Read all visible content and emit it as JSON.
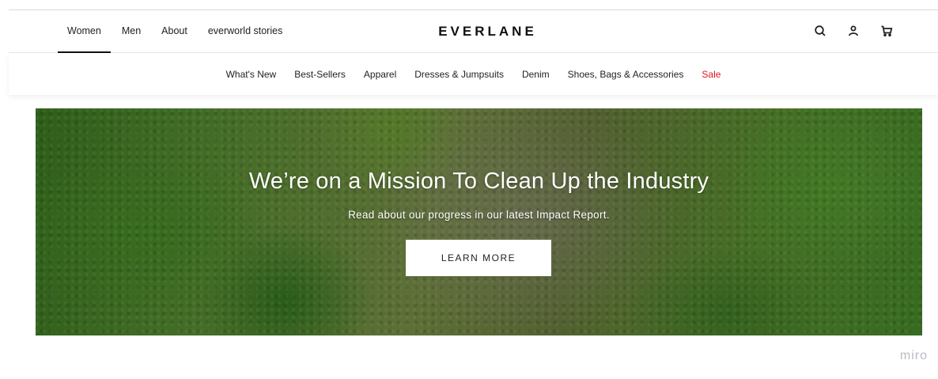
{
  "header": {
    "gender_tabs": [
      "Women",
      "Men",
      "About",
      "everworld stories"
    ],
    "active_tab": "Women",
    "logo": "EVERLANE",
    "icons": [
      "search-icon",
      "account-icon",
      "cart-icon"
    ]
  },
  "category_nav": {
    "items": [
      "What's New",
      "Best-Sellers",
      "Apparel",
      "Dresses & Jumpsuits",
      "Denim",
      "Shoes, Bags & Accessories"
    ],
    "sale_label": "Sale",
    "sale_color": "#e0151d"
  },
  "hero": {
    "title": "We’re on a Mission To Clean Up the Industry",
    "subtitle": "Read about our progress in our latest Impact Report.",
    "button_label": "LEARN MORE"
  },
  "watermark": "miro"
}
